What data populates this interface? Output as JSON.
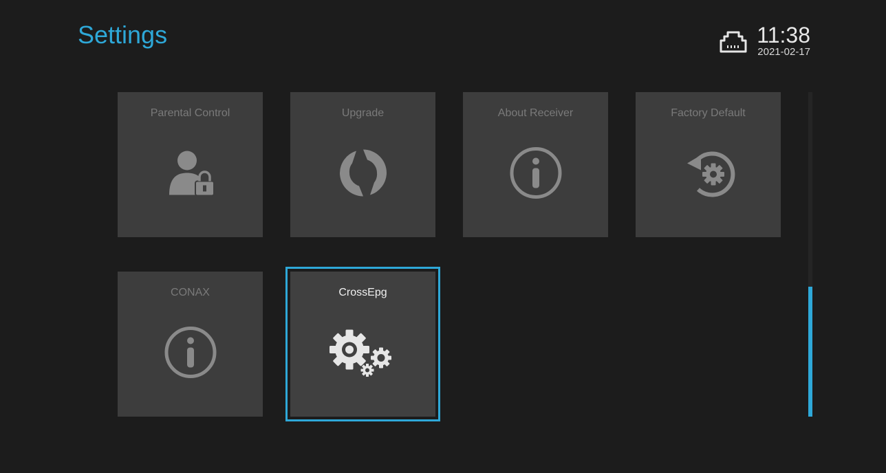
{
  "header": {
    "title": "Settings",
    "time": "11:38",
    "date": "2021-02-17",
    "network_icon": "ethernet-icon"
  },
  "tiles": [
    {
      "label": "Parental Control",
      "icon": "user-lock-icon"
    },
    {
      "label": "Upgrade",
      "icon": "refresh-icon"
    },
    {
      "label": "About Receiver",
      "icon": "info-icon"
    },
    {
      "label": "Factory Default",
      "icon": "restore-gear-icon"
    },
    {
      "label": "CONAX",
      "icon": "info-icon"
    },
    {
      "label": "CrossEpg",
      "icon": "gears-icon",
      "selected": true
    }
  ],
  "scrollbar": {
    "position": "bottom"
  },
  "colors": {
    "accent": "#2ea8d8",
    "tile": "#3d3d3d",
    "background": "#1c1c1c"
  }
}
